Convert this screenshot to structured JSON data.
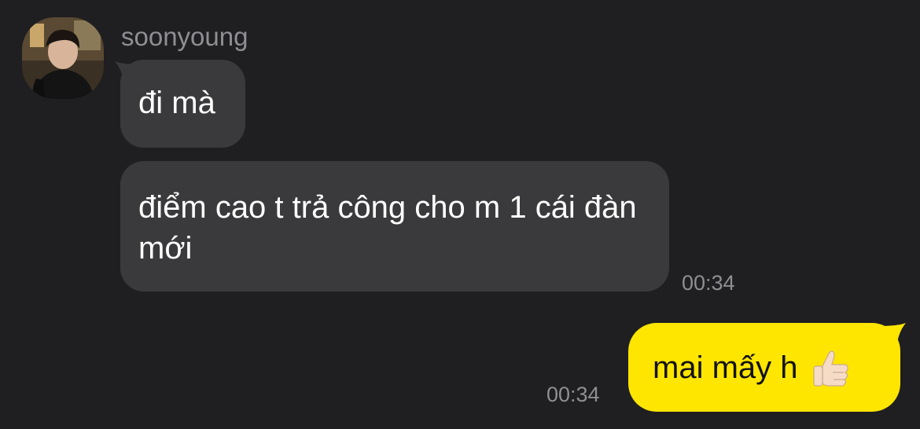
{
  "chat": {
    "sender": {
      "name": "soonyoung",
      "avatar": "avatar-photo"
    },
    "messages": [
      {
        "direction": "incoming",
        "text": "đi mà"
      },
      {
        "direction": "incoming",
        "text": "điểm cao t trả công cho m 1 cái đàn mới",
        "time": "00:34"
      },
      {
        "direction": "outgoing",
        "text": "mai mấy h",
        "emoji": "thumbs-up-icon",
        "time": "00:34"
      }
    ]
  },
  "colors": {
    "background": "#1f1f21",
    "incoming_bubble": "#3a3a3c",
    "outgoing_bubble": "#ffe600",
    "muted_text": "#8e8e93"
  }
}
